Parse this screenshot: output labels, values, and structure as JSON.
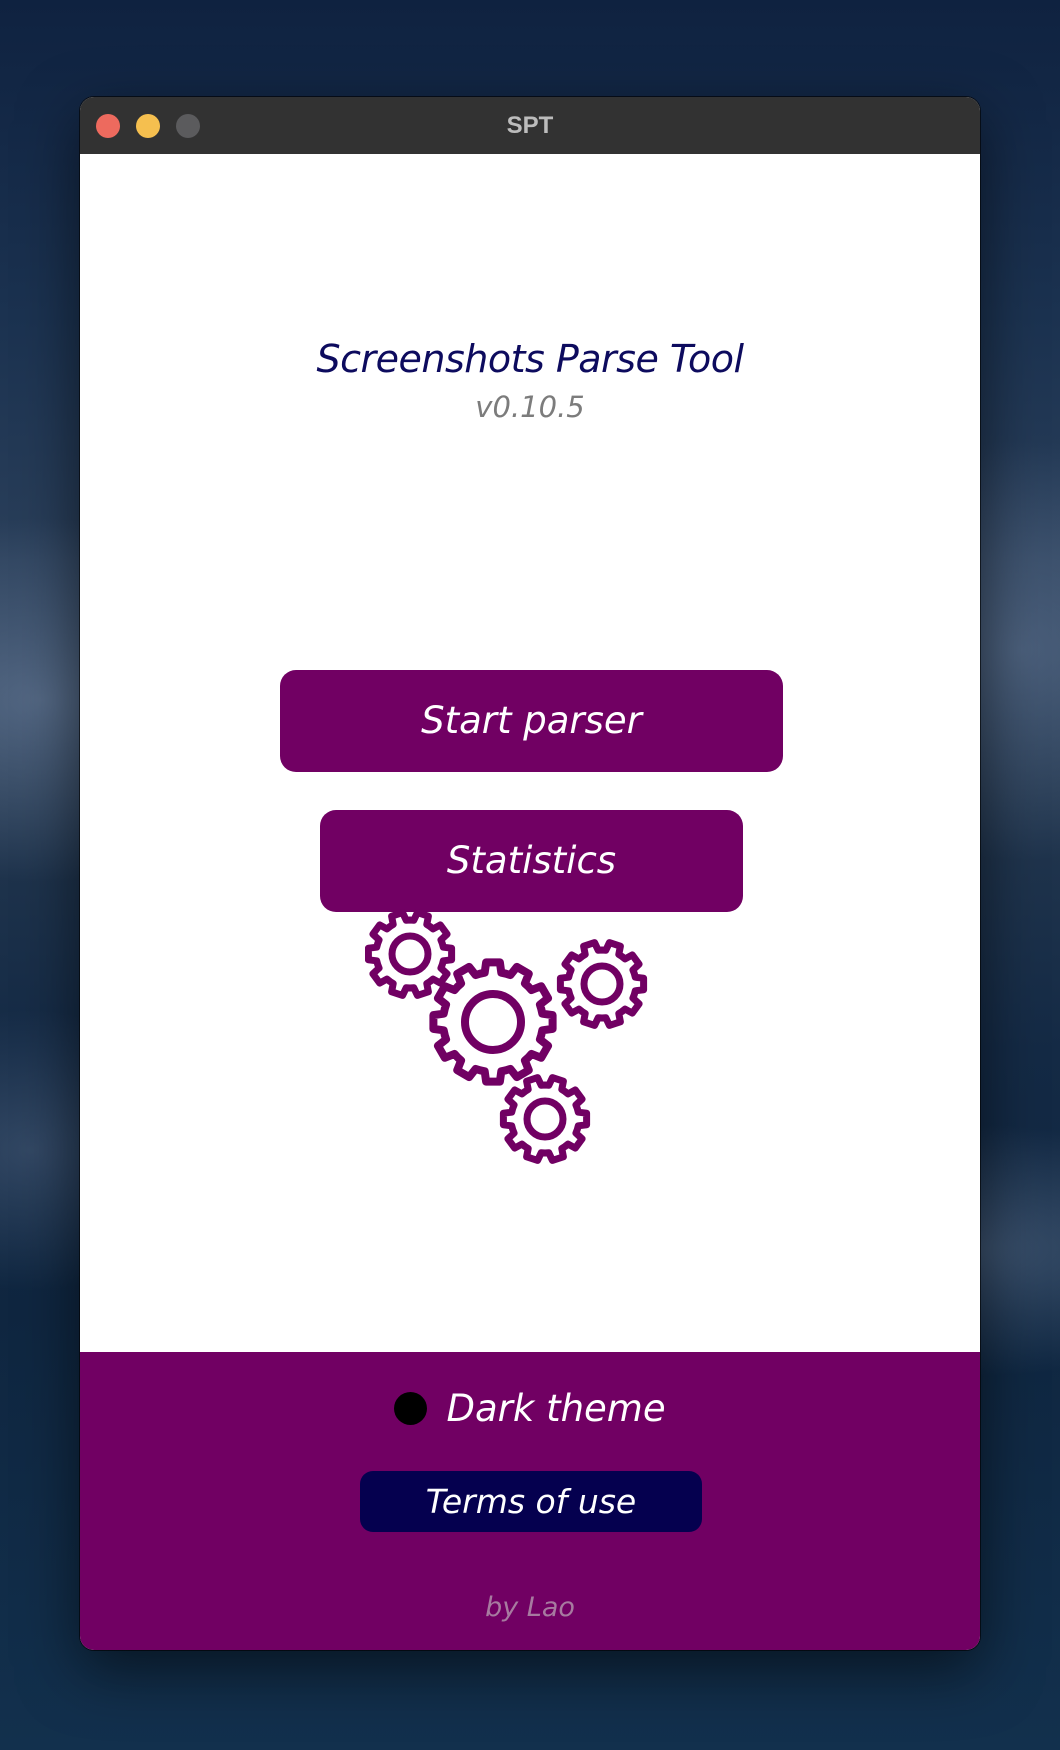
{
  "window": {
    "title": "SPT",
    "controls": [
      "close",
      "minimize",
      "zoom"
    ]
  },
  "app": {
    "title": "Screenshots Parse Tool",
    "version": "v0.10.5"
  },
  "buttons": {
    "start_parser": "Start parser",
    "statistics": "Statistics"
  },
  "illustration": {
    "icon": "gears-icon",
    "color": "#710063"
  },
  "footer": {
    "dark_theme_label": "Dark theme",
    "dark_theme_enabled": false,
    "terms_label": "Terms of use",
    "byline": "by Lao"
  },
  "colors": {
    "accent": "#710063",
    "title_text": "#0d0b5e",
    "terms_button": "#05004f",
    "version_text": "#7c7c7c"
  }
}
